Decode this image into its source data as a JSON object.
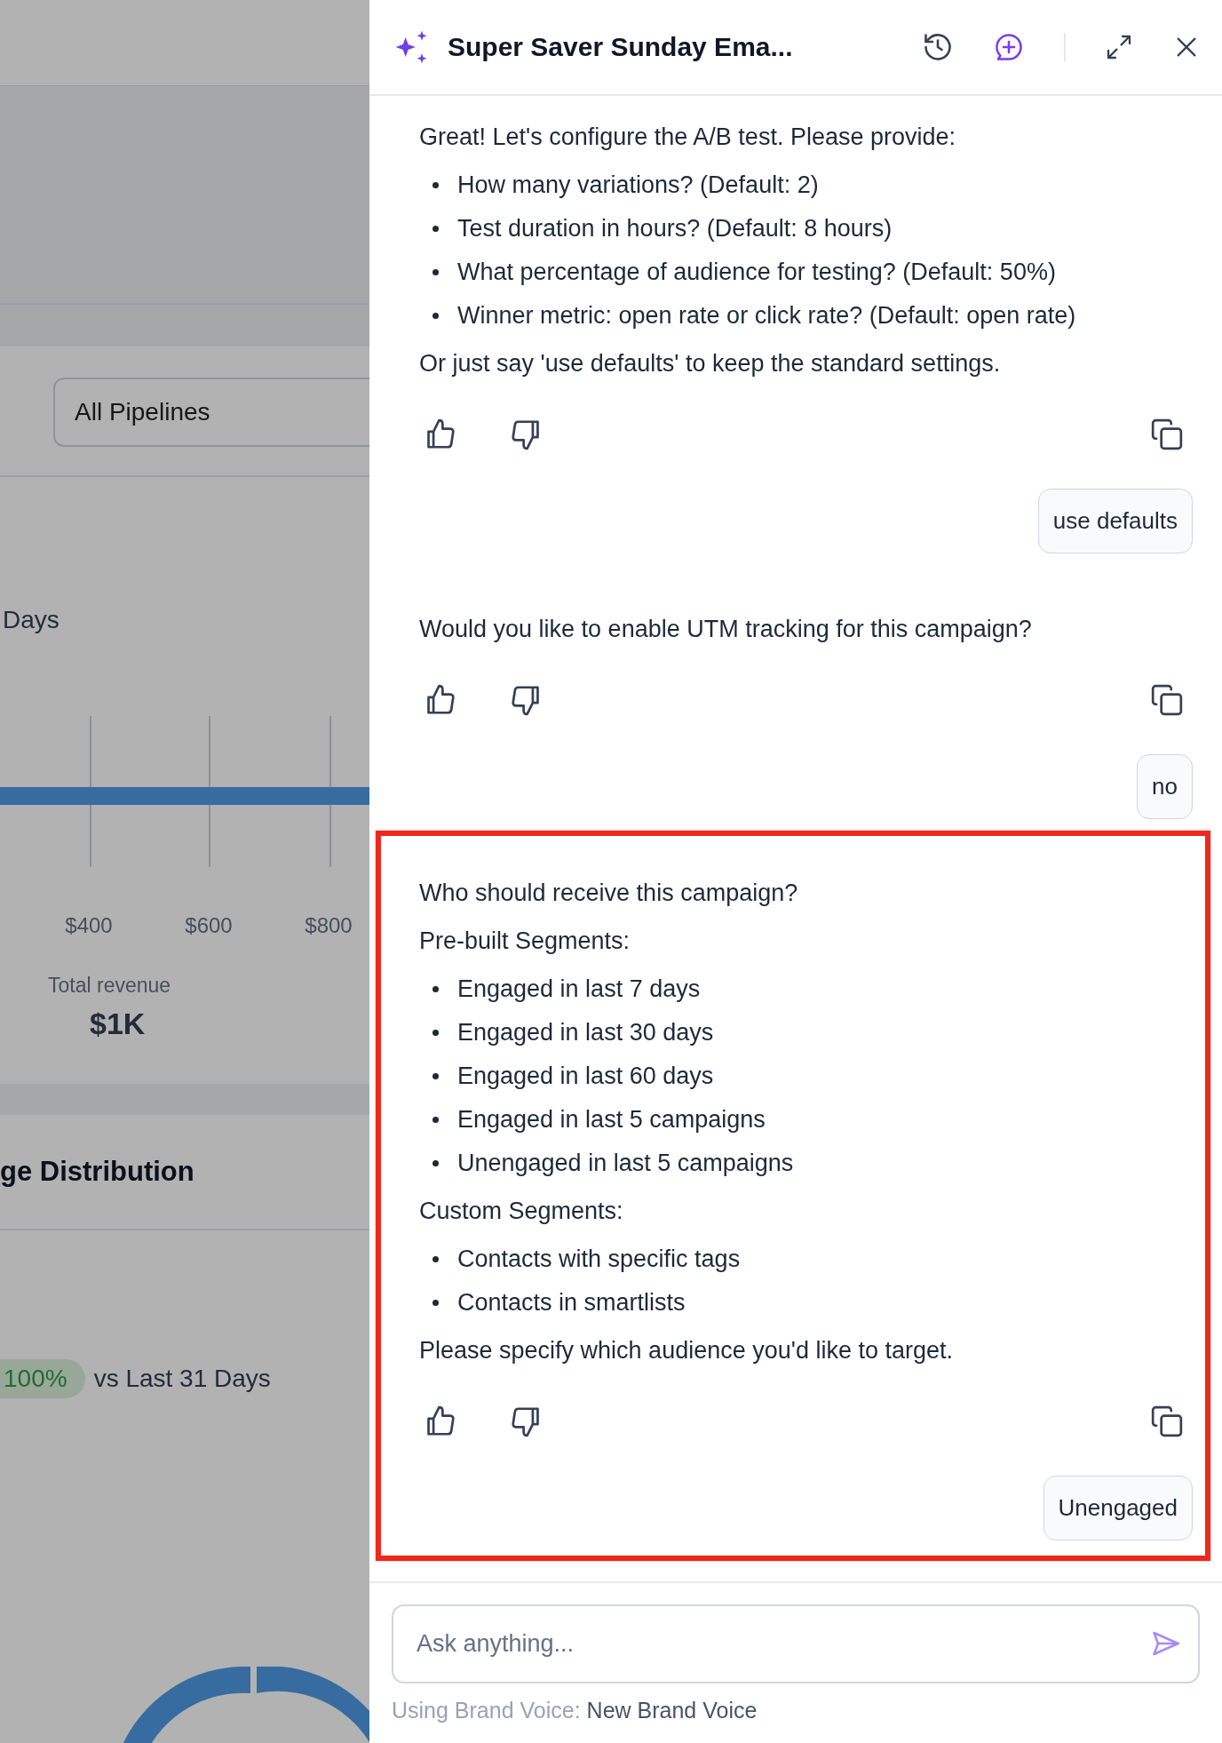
{
  "background_page": {
    "pipeline_filter": "All Pipelines",
    "period_label": "Days",
    "axis_ticks": [
      "$400",
      "$600",
      "$800"
    ],
    "total_label": "Total revenue",
    "total_value": "$1K",
    "section_title": "ge Distribution",
    "change_badge": "100%",
    "comparison": "vs Last 31 Days"
  },
  "panel": {
    "title": "Super Saver Sunday Ema..."
  },
  "messages": [
    {
      "kind": "assistant",
      "highlighted": false,
      "blocks": [
        {
          "kind": "text",
          "text": "Great! Let's configure the A/B test. Please provide:"
        },
        {
          "kind": "list",
          "items": [
            "How many variations? (Default: 2)",
            "Test duration in hours? (Default: 8 hours)",
            "What percentage of audience for testing? (Default: 50%)",
            "Winner metric: open rate or click rate? (Default: open rate)"
          ]
        },
        {
          "kind": "text",
          "text": "Or just say 'use defaults' to keep the standard settings."
        }
      ]
    },
    {
      "kind": "user",
      "text": "use defaults"
    },
    {
      "kind": "assistant",
      "highlighted": false,
      "blocks": [
        {
          "kind": "text",
          "text": "Would you like to enable UTM tracking for this campaign?"
        }
      ]
    },
    {
      "kind": "user",
      "text": "no"
    },
    {
      "kind": "assistant",
      "highlighted": true,
      "blocks": [
        {
          "kind": "text",
          "text": "Who should receive this campaign?"
        },
        {
          "kind": "text",
          "text": "Pre-built Segments:"
        },
        {
          "kind": "list",
          "items": [
            "Engaged in last 7 days",
            "Engaged in last 30 days",
            "Engaged in last 60 days",
            "Engaged in last 5 campaigns",
            "Unengaged in last 5 campaigns"
          ]
        },
        {
          "kind": "text",
          "text": "Custom Segments:"
        },
        {
          "kind": "list",
          "items": [
            "Contacts with specific tags",
            "Contacts in smartlists"
          ]
        },
        {
          "kind": "text",
          "text": "Please specify which audience you'd like to target."
        }
      ],
      "reply": "Unengaged"
    }
  ],
  "composer": {
    "placeholder": "Ask anything...",
    "brand_label": "Using Brand Voice:",
    "brand_value": "New Brand Voice"
  }
}
